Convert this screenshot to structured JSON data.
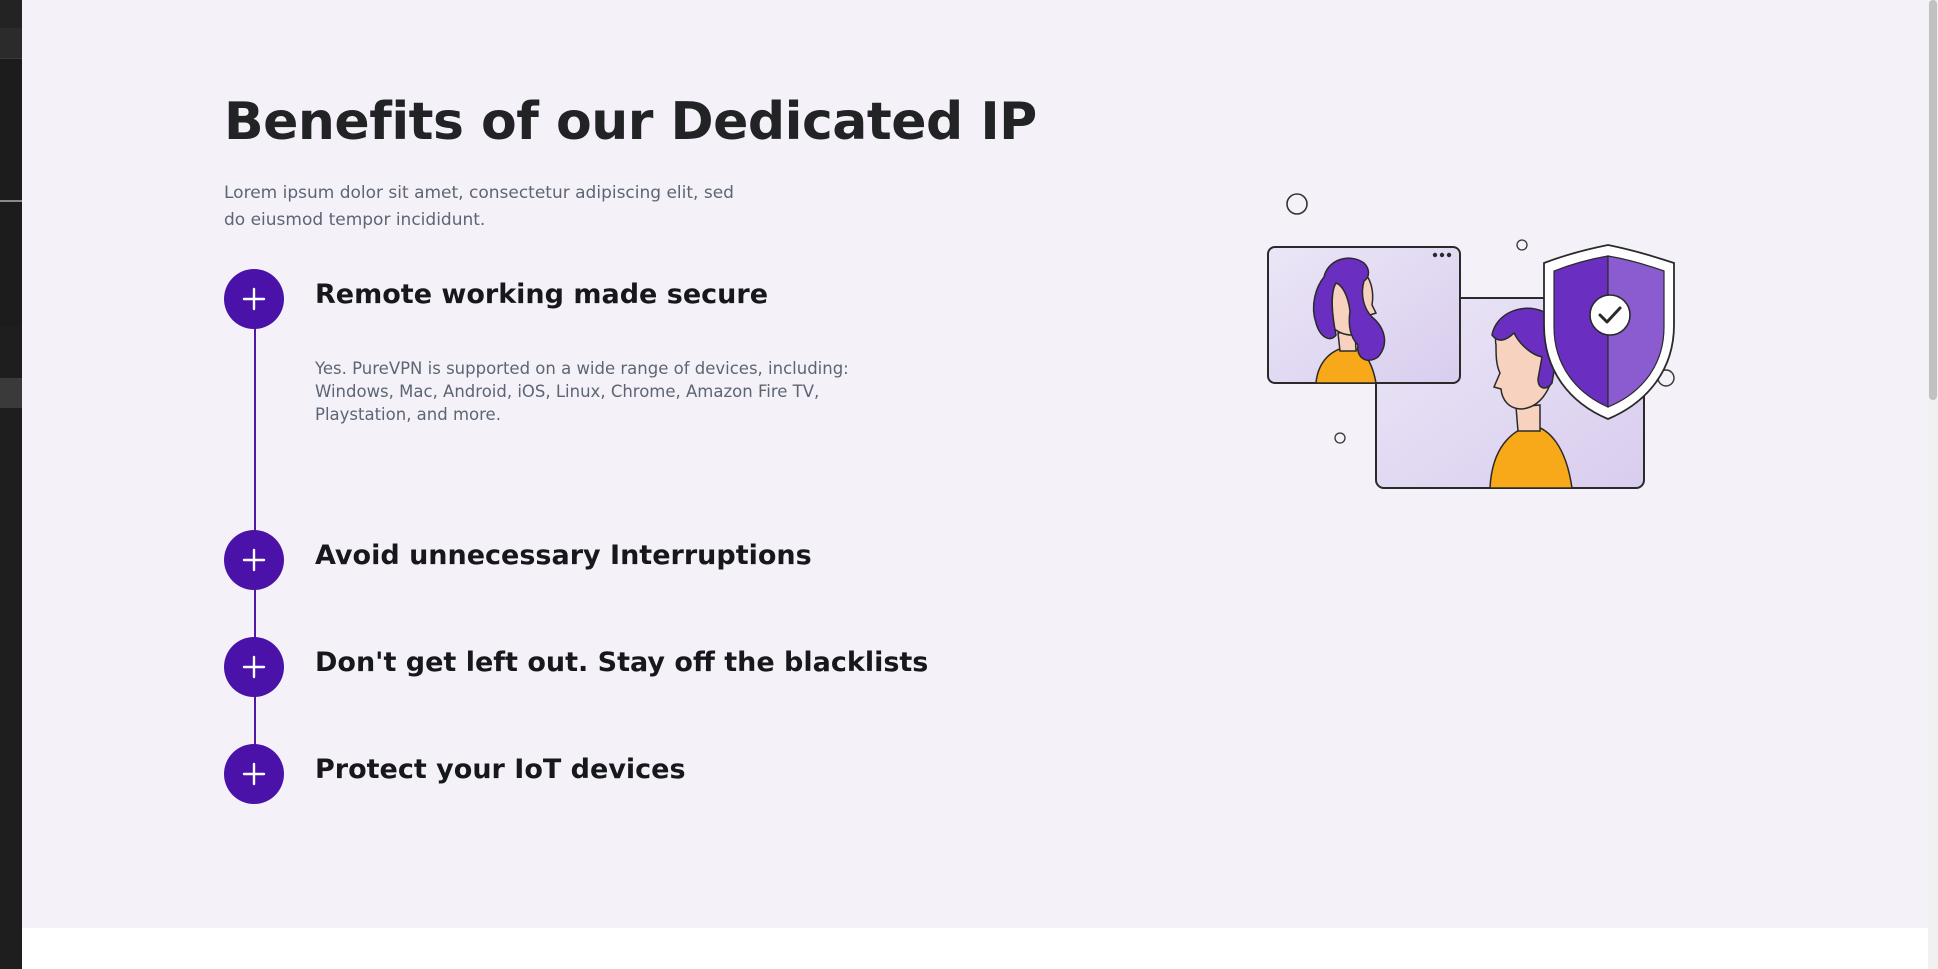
{
  "page": {
    "title": "Benefits of our Dedicated IP",
    "subtitle": "Lorem ipsum dolor sit amet, consectetur adipiscing elit, sed do eiusmod tempor incididunt."
  },
  "accordion": {
    "items": [
      {
        "heading": "Remote working made secure",
        "expanded": true,
        "body": "Yes. PureVPN is supported on a wide range of devices, including: Windows, Mac, Android, iOS, Linux, Chrome, Amazon Fire TV, Playstation, and more.",
        "icon": "plus-icon"
      },
      {
        "heading": "Avoid unnecessary Interruptions",
        "expanded": false,
        "icon": "plus-icon"
      },
      {
        "heading": "Don't get left out. Stay off the blacklists",
        "expanded": false,
        "icon": "plus-icon"
      },
      {
        "heading": "Protect your IoT devices",
        "expanded": false,
        "icon": "plus-icon"
      }
    ]
  },
  "colors": {
    "accent": "#4a12a8",
    "background": "#f4f2f8",
    "heading": "#17181c",
    "muted_text": "#5d6574",
    "shield_dark": "#6a2fc0",
    "shield_light": "#8a5ccf",
    "shirt": "#f8a91a"
  },
  "illustration": {
    "icon": "video-call-shield-illustration"
  }
}
